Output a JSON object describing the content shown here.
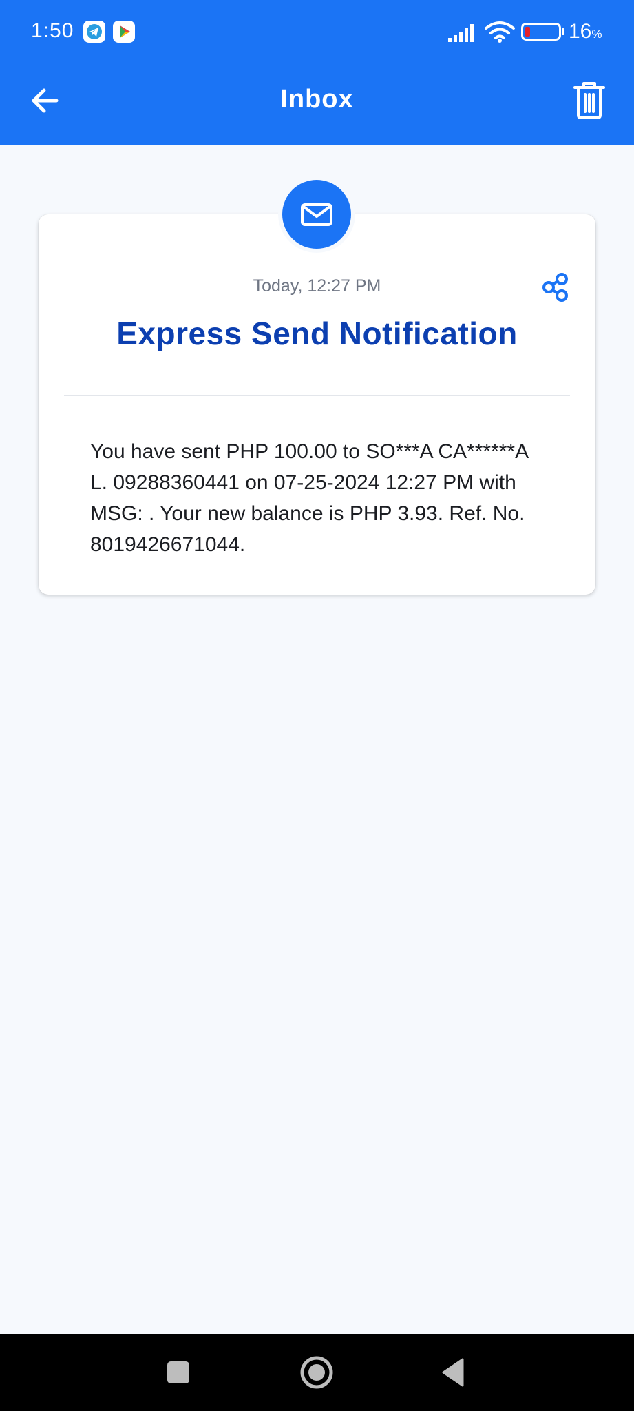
{
  "status_bar": {
    "time": "1:50",
    "battery_percent": "16",
    "battery_unit": "%",
    "battery_level": 0.16,
    "icons": [
      "telegram-icon",
      "play-store-icon",
      "signal-icon",
      "wifi-icon",
      "battery-icon"
    ]
  },
  "toolbar": {
    "title": "Inbox",
    "back_icon": "arrow-left-icon",
    "delete_icon": "trash-icon"
  },
  "message": {
    "icon": "envelope-icon",
    "timestamp": "Today, 12:27 PM",
    "share_icon": "share-icon",
    "title": "Express Send Notification",
    "body": "You have sent PHP 100.00 to SO***A CA******A L. 09288360441 on 07-25-2024 12:27 PM with MSG: . Your new balance is PHP 3.93. Ref. No. 8019426671044."
  },
  "nav_bar": {
    "icons": [
      "recents-square-icon",
      "home-circle-icon",
      "back-triangle-icon"
    ]
  },
  "colors": {
    "primary": "#1b74f5",
    "title": "#0c3fb0",
    "background": "#f6f9fd",
    "battery_low": "#e5212a"
  }
}
